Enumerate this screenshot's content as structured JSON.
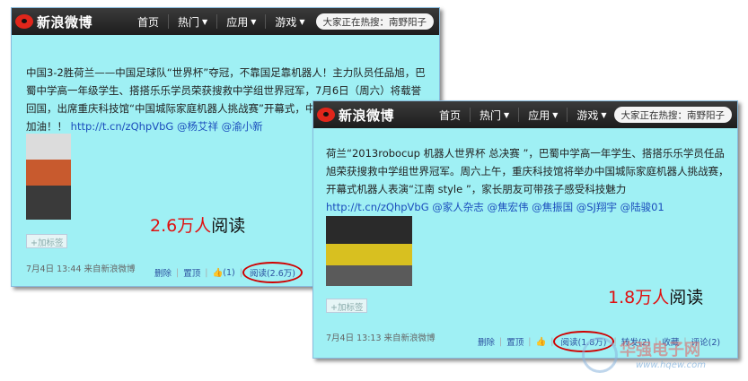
{
  "nav": {
    "logo": "新浪微博",
    "items": [
      "首页",
      "热门",
      "应用",
      "游戏"
    ],
    "hot_search": "大家正在热搜：南野阳子"
  },
  "post_a": {
    "text": "中国3-2胜荷兰——中国足球队“世界杯”夺冠，不靠国足靠机器人！主力队员任品旭，巴蜀中学高一年级学生、搭搭乐乐学员荣获搜救中学组世界冠军，7月6日（周六）将载誉回国，出席重庆科技馆“中国城际家庭机器人挑战赛”开幕式，中国足球靠机器人来振兴，加油！！",
    "link": "http://t.cn/zQhpVbG",
    "mentions": "@杨艾祥 @渝小新",
    "tag_button": "+加标签",
    "stat_number": "2.6万人",
    "stat_word": "阅读",
    "meta": "7月4日 13:44   来自新浪微博",
    "actions": {
      "delete": "删除",
      "pin": "置顶",
      "like": "(1)",
      "reads": "阅读(2.6万)"
    }
  },
  "post_b": {
    "text": "荷兰“2013robocup 机器人世界杯 总决赛 ”，巴蜀中学高一年学生、搭搭乐乐学员任品旭荣获搜救中学组世界冠军。周六上午，重庆科技馆将举办中国城际家庭机器人挑战赛，开幕式机器人表演“江南 style ”，家长朋友可带孩子感受科技魅力",
    "link": "http://t.cn/zQhpVbG",
    "mentions": "@家人杂志 @焦宏伟 @焦振国 @SJ翔宇 @陆骏01",
    "tag_button": "+加标签",
    "stat_number": "1.8万人",
    "stat_word": "阅读",
    "meta": "7月4日 13:13   来自新浪微博",
    "actions": {
      "delete": "删除",
      "pin": "置顶",
      "reads": "阅读(1.8万)",
      "forward": "转发(2)",
      "favorite": "收藏",
      "comment": "评论(2)"
    }
  },
  "watermark": {
    "text": "华强电子网",
    "url": "www.hqew.com"
  }
}
